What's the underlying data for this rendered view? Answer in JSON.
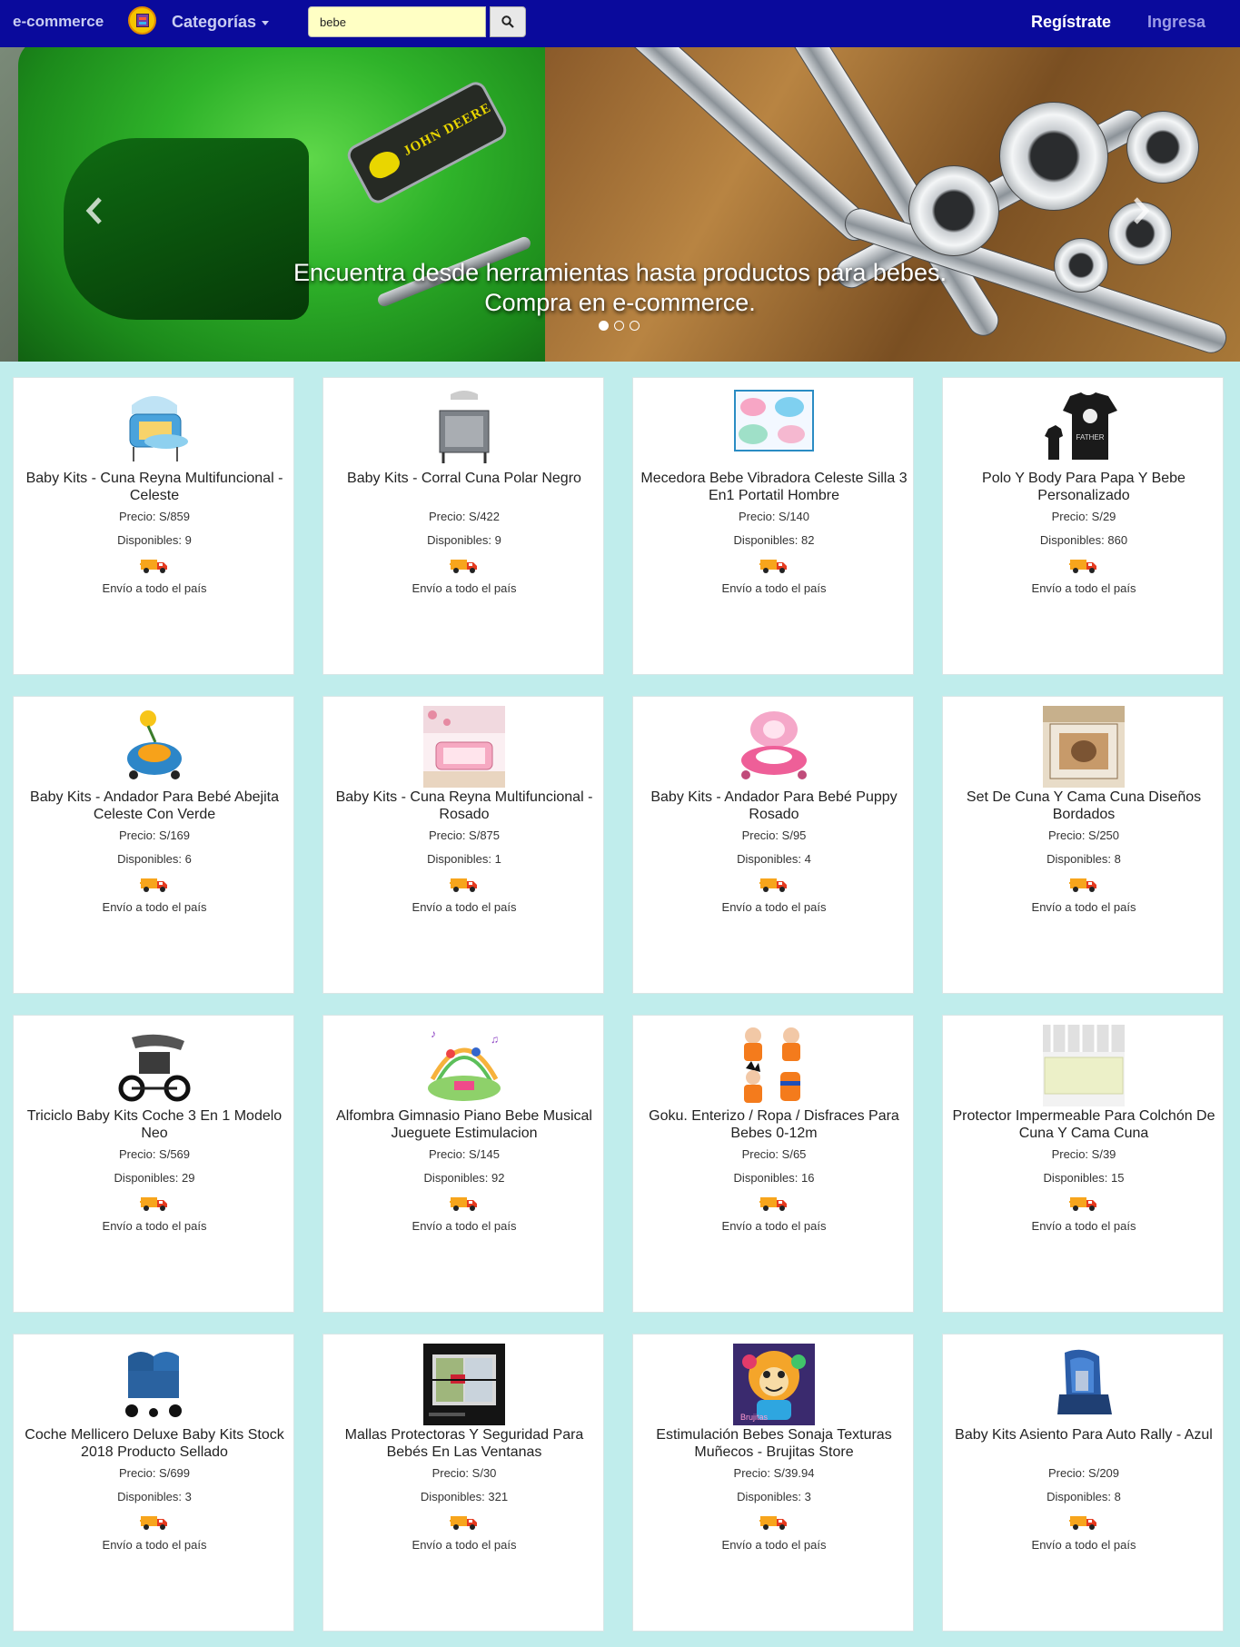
{
  "nav": {
    "brand": "e-commerce",
    "categories": "Categorías",
    "search_value": "bebe",
    "register": "Regístrate",
    "login": "Ingresa"
  },
  "hero": {
    "caption_line1": "Encuentra desde herramientas hasta productos para bebes.",
    "caption_line2": "Compra en e-commerce.",
    "slides": 3,
    "active_slide": 1
  },
  "card_labels": {
    "price_prefix": "Precio: S/",
    "stock_prefix": "Disponibles: ",
    "shipping": "Envío a todo el país"
  },
  "products": [
    {
      "title": "Baby Kits - Cuna Reyna Multifuncional - Celeste",
      "price": "859",
      "stock": "9",
      "thumb": "crib-blue"
    },
    {
      "title": "Baby Kits - Corral Cuna Polar Negro",
      "price": "422",
      "stock": "9",
      "thumb": "playpen-grey"
    },
    {
      "title": "Mecedora Bebe Vibradora Celeste Silla 3 En1 Portatil Hombre",
      "price": "140",
      "stock": "82",
      "thumb": "bouncer-collage"
    },
    {
      "title": "Polo Y Body Para Papa Y Bebe Personalizado",
      "price": "29",
      "stock": "860",
      "thumb": "tshirt-black"
    },
    {
      "title": "Baby Kits - Andador Para Bebé Abejita Celeste Con Verde",
      "price": "169",
      "stock": "6",
      "thumb": "walker-bee"
    },
    {
      "title": "Baby Kits - Cuna Reyna Multifuncional - Rosado",
      "price": "875",
      "stock": "1",
      "thumb": "crib-pink"
    },
    {
      "title": "Baby Kits - Andador Para Bebé Puppy Rosado",
      "price": "95",
      "stock": "4",
      "thumb": "walker-pink"
    },
    {
      "title": "Set De Cuna Y Cama Cuna Diseños Bordados",
      "price": "250",
      "stock": "8",
      "thumb": "crib-bedding"
    },
    {
      "title": "Triciclo Baby Kits Coche 3 En 1 Modelo Neo",
      "price": "569",
      "stock": "29",
      "thumb": "tricycle"
    },
    {
      "title": "Alfombra Gimnasio Piano Bebe Musical Jueguete Estimulacion",
      "price": "145",
      "stock": "92",
      "thumb": "play-gym"
    },
    {
      "title": "Goku. Enterizo / Ropa / Disfraces Para Bebes 0-12m",
      "price": "65",
      "stock": "16",
      "thumb": "goku-costume"
    },
    {
      "title": "Protector Impermeable Para Colchón De Cuna Y Cama Cuna",
      "price": "39",
      "stock": "15",
      "thumb": "mattress-protector"
    },
    {
      "title": "Coche Mellicero Deluxe Baby Kits Stock 2018 Producto Sellado",
      "price": "699",
      "stock": "3",
      "thumb": "twin-stroller"
    },
    {
      "title": "Mallas Protectoras Y Seguridad Para Bebés En Las Ventanas",
      "price": "30",
      "stock": "321",
      "thumb": "window-mesh"
    },
    {
      "title": "Estimulación Bebes Sonaja Texturas Muñecos - Brujitas Store",
      "price": "39.94",
      "stock": "3",
      "thumb": "monkey-rattle"
    },
    {
      "title": "Baby Kits Asiento Para Auto Rally - Azul",
      "price": "209",
      "stock": "8",
      "thumb": "car-seat"
    }
  ],
  "colors": {
    "navbar": "#0a0a9c",
    "page_bg": "#c0edec",
    "search_bg": "#ffffc4",
    "card_bg": "#ffffff"
  }
}
